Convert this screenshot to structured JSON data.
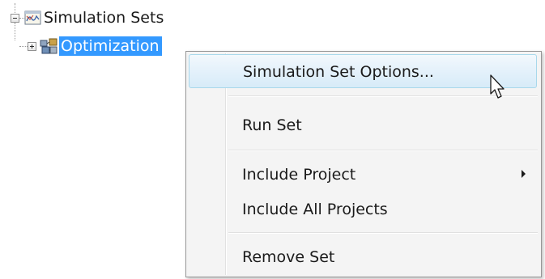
{
  "tree": {
    "root": {
      "label": "Simulation Sets",
      "expanded": true,
      "icon": "simulation-sets-icon"
    },
    "child": {
      "label": "Optimization",
      "expanded": false,
      "selected": true,
      "icon": "optimization-set-icon"
    }
  },
  "context_menu": {
    "items": [
      {
        "label": "Simulation Set Options...",
        "highlighted": true
      },
      {
        "label": "Run Set"
      },
      {
        "label": "Include Project",
        "has_submenu": true,
        "submenu_icon": "submenu-arrow-icon"
      },
      {
        "label": "Include All Projects"
      },
      {
        "label": "Remove Set"
      }
    ]
  },
  "colors": {
    "selection": "#3399ff",
    "menu_background": "#f4f4f4",
    "menu_hover": "#d7ebf8",
    "menu_border": "#979797"
  },
  "cursor_icon": "arrow-cursor-icon"
}
